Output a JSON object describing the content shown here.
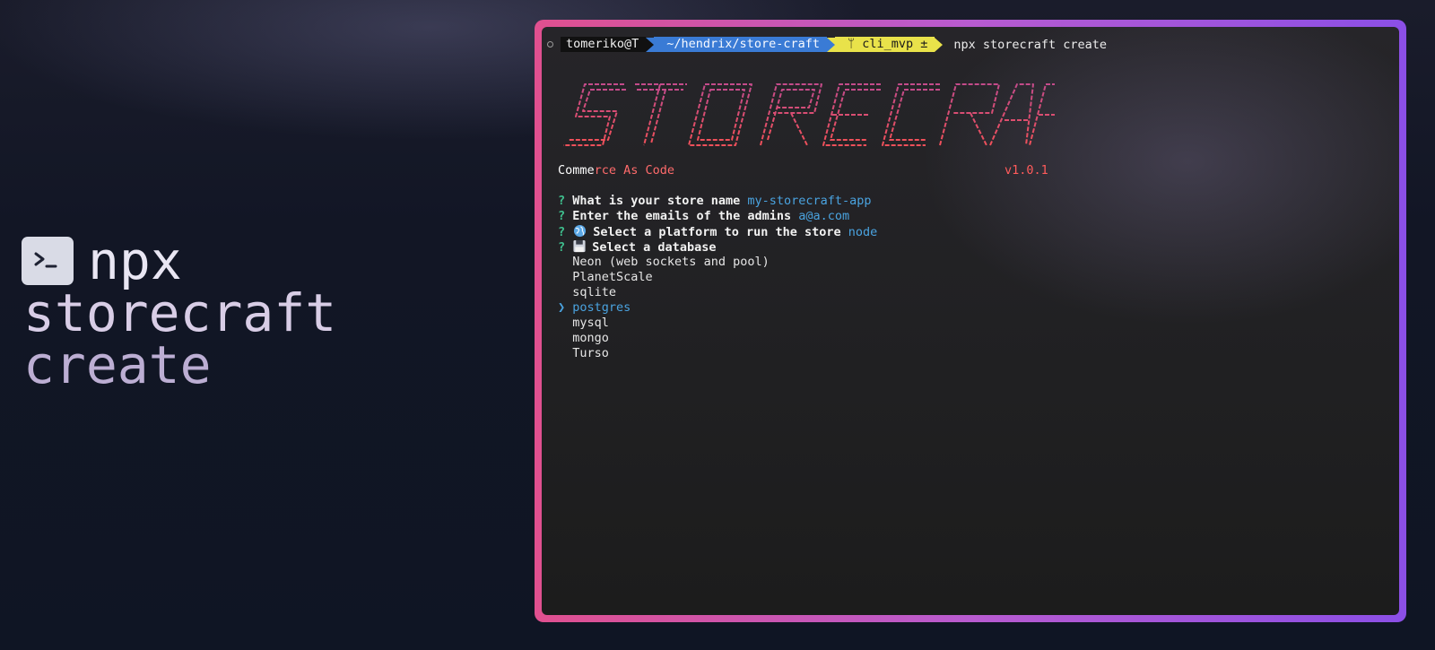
{
  "hero": {
    "icon": "terminal-icon",
    "word1": "npx",
    "word2": "storecraft",
    "word3": "create"
  },
  "terminal": {
    "prompt": {
      "user": "tomeriko@T",
      "path": "~/hendrix/store-craft",
      "branch": "cli_mvp ±",
      "command": "npx storecraft create"
    },
    "banner": {
      "logo_text": "STORE CRAFT",
      "tagline_part1": "Comme",
      "tagline_part2": "rce As Code",
      "version": "v1.0.1"
    },
    "questions": [
      {
        "mark": "?",
        "label": "What is your store name",
        "answer": "my-storecraft-app",
        "icon": ""
      },
      {
        "mark": "?",
        "label": "Enter the emails of the admins",
        "answer": "a@a.com",
        "icon": ""
      },
      {
        "mark": "?",
        "label": "Select a platform to run the store",
        "answer": "node",
        "icon": "globe-icon"
      },
      {
        "mark": "?",
        "label": "Select a database",
        "answer": "",
        "icon": "floppy-disk-icon"
      }
    ],
    "database_options": [
      "Neon (web sockets and pool)",
      "PlanetScale",
      "sqlite",
      "postgres",
      "mysql",
      "mongo",
      "Turso"
    ],
    "selected_option": "postgres",
    "pointer": "❯"
  },
  "colors": {
    "frame_gradient_start": "#e0508f",
    "frame_gradient_end": "#8b4fe6",
    "question_mark": "#3fbf8e",
    "answer": "#4aa3e0",
    "logo": "#e0506a",
    "version": "#ff5b5b"
  }
}
